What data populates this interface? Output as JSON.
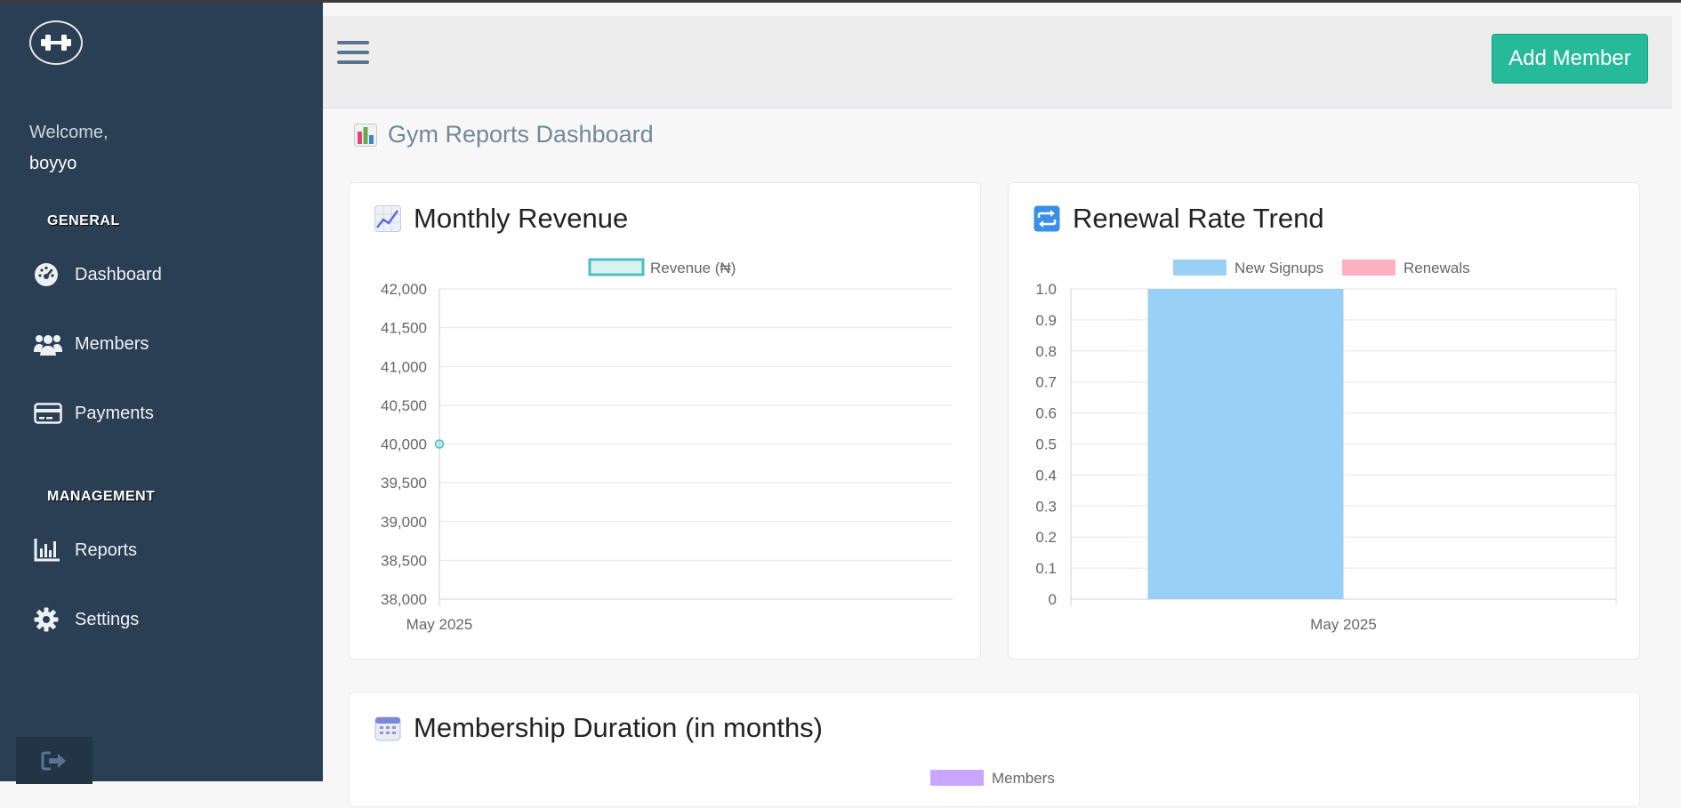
{
  "sidebar": {
    "welcome_label": "Welcome,",
    "username": "boyyo",
    "section_general": "GENERAL",
    "section_management": "MANAGEMENT",
    "items": [
      {
        "label": "Dashboard",
        "icon": "dashboard-gauge-icon"
      },
      {
        "label": "Members",
        "icon": "users-icon"
      },
      {
        "label": "Payments",
        "icon": "credit-card-icon"
      },
      {
        "label": "Reports",
        "icon": "bar-chart-icon"
      },
      {
        "label": "Settings",
        "icon": "gear-icon"
      }
    ],
    "logout_icon": "sign-out-icon",
    "logo_icon": "dumbbell-icon",
    "bg_color": "#2a3f54"
  },
  "header": {
    "menu_icon": "hamburger-icon",
    "add_member_label": "Add Member",
    "accent_color": "#26b99a"
  },
  "page": {
    "title": "Gym Reports Dashboard",
    "title_icon": "bar-chart-emoji-icon"
  },
  "panels": {
    "revenue": {
      "title": "Monthly Revenue",
      "icon": "chart-increasing-emoji-icon"
    },
    "renewal": {
      "title": "Renewal Rate Trend",
      "icon": "repeat-arrows-emoji-icon"
    },
    "duration": {
      "title": "Membership Duration (in months)",
      "icon": "calendar-emoji-icon"
    }
  },
  "chart_data": [
    {
      "type": "line",
      "categories": [
        "May 2025"
      ],
      "series": [
        {
          "name": "Revenue (₦)",
          "values": [
            40000
          ],
          "color": "#4bc0c0"
        }
      ],
      "ylim": [
        38000,
        42000
      ],
      "yticks": [
        "42,000",
        "41,500",
        "41,000",
        "40,500",
        "40,000",
        "39,500",
        "39,000",
        "38,500",
        "38,000"
      ],
      "legend": "top-center",
      "grid": true
    },
    {
      "type": "bar",
      "categories": [
        "May 2025"
      ],
      "series": [
        {
          "name": "New Signups",
          "values": [
            1
          ],
          "color": "#9ad0f5"
        },
        {
          "name": "Renewals",
          "values": [
            0
          ],
          "color": "#ffb1c1"
        }
      ],
      "ylim": [
        0,
        1
      ],
      "yticks": [
        "1.0",
        "0.9",
        "0.8",
        "0.7",
        "0.6",
        "0.5",
        "0.4",
        "0.3",
        "0.2",
        "0.1",
        "0"
      ],
      "legend": "top-center",
      "grid": true
    },
    {
      "type": "bar",
      "categories": [],
      "series": [
        {
          "name": "Members",
          "values": [],
          "color": "#c9a6ff"
        }
      ],
      "legend": "top-center"
    }
  ]
}
